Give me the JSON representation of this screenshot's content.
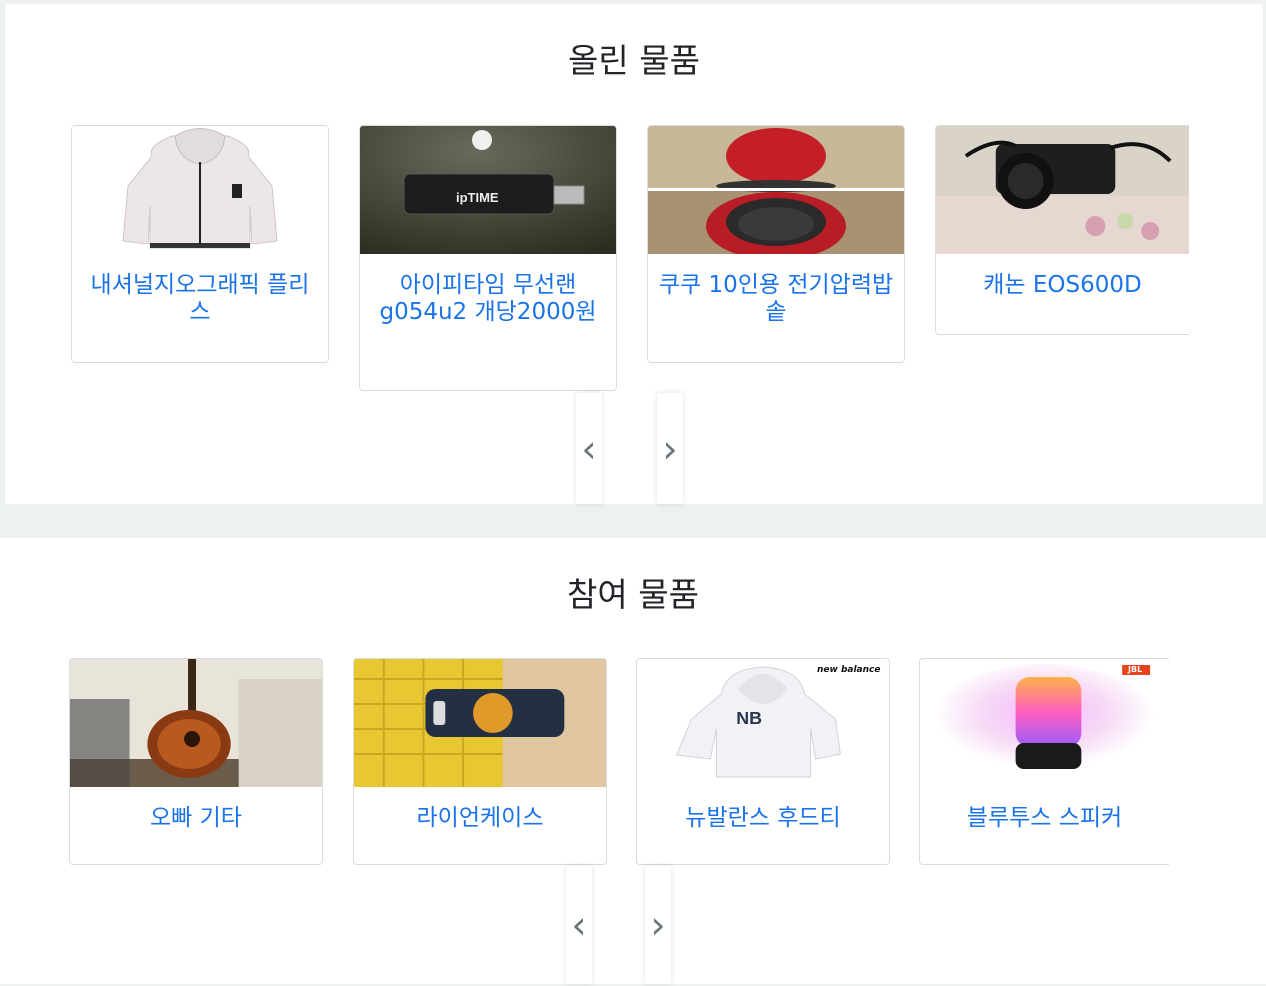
{
  "uploaded": {
    "title": "올린 물품",
    "items": [
      {
        "name": "내셔널지오그래픽 플리스",
        "image": "white-fleece-jacket"
      },
      {
        "name": "아이피타임 무선랜 g054u2 개당2000원",
        "image": "iptime-usb-wifi"
      },
      {
        "name": "쿠쿠 10인용 전기압력밥솥",
        "image": "red-rice-cooker"
      },
      {
        "name": "캐논 EOS600D",
        "image": "canon-camera"
      }
    ],
    "prev_label": "‹",
    "next_label": "›"
  },
  "joined": {
    "title": "참여 물품",
    "items": [
      {
        "name": "오빠 기타",
        "image": "acoustic-guitar"
      },
      {
        "name": "라이언케이스",
        "image": "ryan-phone-case"
      },
      {
        "name": "뉴발란스 후드티",
        "image": "new-balance-hoodie",
        "logo": "new balance"
      },
      {
        "name": "블루투스 스피커",
        "image": "jbl-speaker",
        "logo": "JBL"
      }
    ],
    "prev_label": "‹",
    "next_label": "›"
  },
  "colors": {
    "link": "#1a73e8",
    "background": "#eef1f2"
  }
}
